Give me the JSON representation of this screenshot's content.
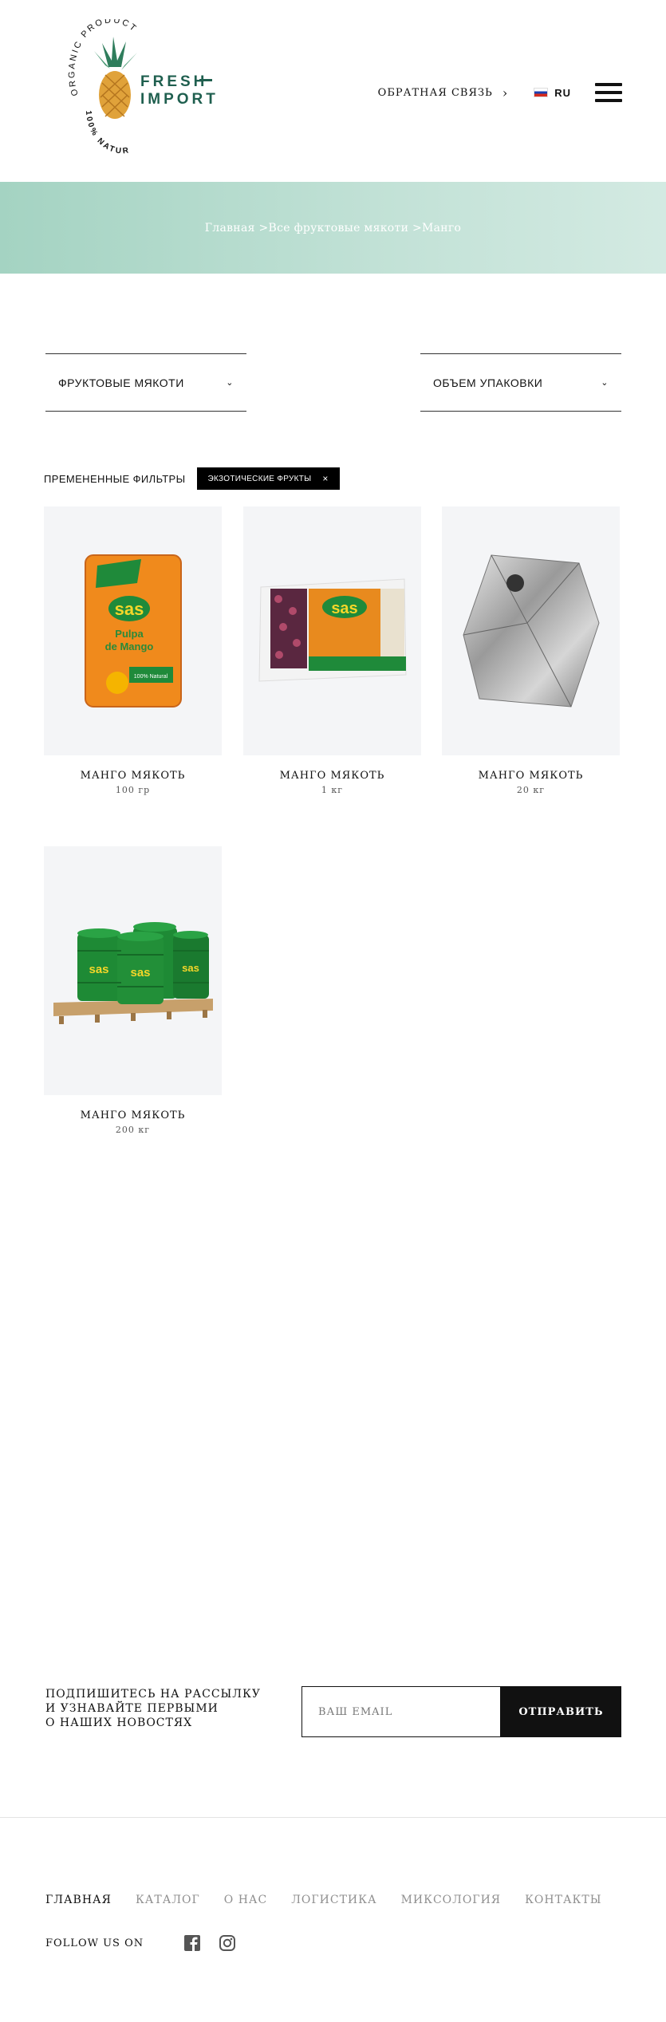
{
  "header": {
    "logo": {
      "ring_text": "ORGANIC PRODUCT",
      "ring_text_bottom": "100% NATURAL",
      "brand_top": "FRESH",
      "brand_bottom": "IMPORT"
    },
    "feedback_label": "ОБРАТНАЯ СВЯЗЬ",
    "lang_label": "RU"
  },
  "breadcrumbs": {
    "home": "Главная",
    "sep1": " >",
    "category": "Все фруктовые мякоти",
    "sep2": " >",
    "current": "Манго"
  },
  "filters": {
    "category_label": "ФРУКТОВЫЕ МЯКОТИ",
    "volume_label": "ОБЪЕМ УПАКОВКИ",
    "applied_label": "ПРЕМЕНЕННЫЕ ФИЛЬТРЫ",
    "applied_chip": "ЭКЗОТИЧЕСКИЕ ФРУКТЫ",
    "chip_close": "×"
  },
  "products": [
    {
      "name": "МАНГО МЯКОТЬ",
      "volume": "100 гр",
      "image": "sas-pouch-small"
    },
    {
      "name": "МАНГО МЯКОТЬ",
      "volume": "1 кг",
      "image": "sas-pack-1kg"
    },
    {
      "name": "МАНГО МЯКОТЬ",
      "volume": "20 кг",
      "image": "foil-bag-in-box"
    },
    {
      "name": "МАНГО МЯКОТЬ",
      "volume": "200 кг",
      "image": "sas-drums-pallet"
    }
  ],
  "product_image_text": {
    "brand": "sas",
    "pouch_line1": "Pulpa",
    "pouch_line2": "de Mango",
    "pouch_badge": "100% Natural"
  },
  "newsletter": {
    "line1": "ПОДПИШИТЕСЬ НА РАССЫЛКУ",
    "line2": "И УЗНАВАЙТЕ ПЕРВЫМИ",
    "line3": "О НАШИХ НОВОСТЯХ",
    "email_placeholder": "ВАШ EMAIL",
    "submit_label": "ОТПРАВИТЬ"
  },
  "footer": {
    "nav": [
      "ГЛАВНАЯ",
      "КАТАЛОГ",
      "О НАС",
      "ЛОГИСТИКА",
      "МИКСОЛОГИЯ",
      "КОНТАКТЫ"
    ],
    "follow_label": "FOLLOW US ON",
    "social_icons": [
      "facebook-icon",
      "instagram-icon"
    ]
  },
  "colors": {
    "brand_green": "#1f5f4f",
    "banner": "#a4d3c2",
    "pouch_orange": "#f08a1c",
    "sas_green": "#1f8a3a"
  }
}
